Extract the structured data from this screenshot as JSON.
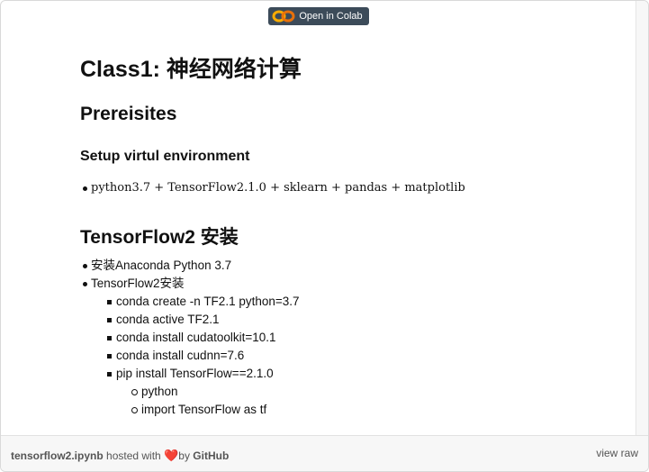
{
  "badge": {
    "label": "Open in Colab"
  },
  "notebook": {
    "title": "Class1: 神经网络计算",
    "prereq_heading": "Prereisites",
    "setup_heading": "Setup virtul environment",
    "setup_items": [
      "python3.7 + TensorFlow2.1.0 + sklearn + pandas + matplotlib"
    ],
    "tf_heading": "TensorFlow2 安装",
    "install": {
      "item1": "安装Anaconda Python 3.7",
      "item2": "TensorFlow2安装",
      "steps": [
        "conda create -n TF2.1 python=3.7",
        "conda active TF2.1",
        "conda install cudatoolkit=10.1",
        "conda install cudnn=7.6",
        "pip install TensorFlow==2.1.0"
      ],
      "sub_steps": [
        "python",
        "import TensorFlow as tf"
      ]
    }
  },
  "footer": {
    "filename": "tensorflow2.ipynb",
    "hosted_with": "hosted with",
    "by": "by",
    "github": "GitHub",
    "view_raw": "view raw"
  }
}
